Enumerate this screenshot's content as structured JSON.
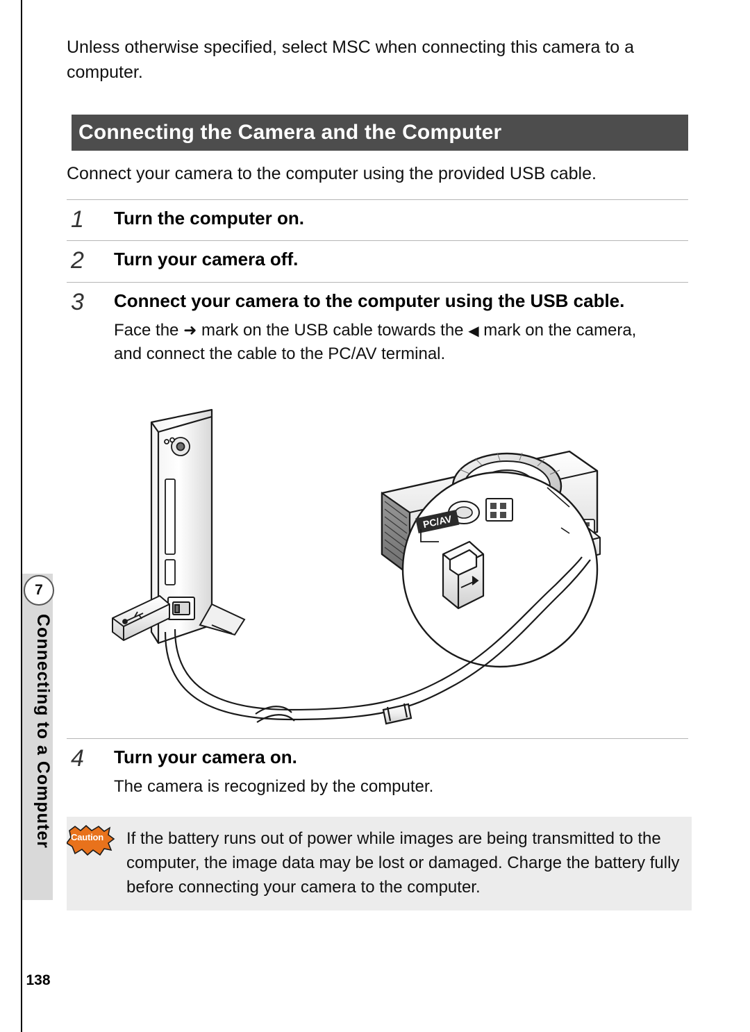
{
  "page": {
    "number": "138",
    "chapter_badge": "7",
    "side_tab_label": "Connecting to a Computer"
  },
  "intro": {
    "text": "Unless otherwise specified, select MSC when connecting this camera to a computer."
  },
  "section": {
    "title": "Connecting the Camera and the Computer",
    "lead": "Connect your camera to the computer using the provided USB cable."
  },
  "steps": [
    {
      "number": "1",
      "title": "Turn the computer on.",
      "body": ""
    },
    {
      "number": "2",
      "title": "Turn your camera off.",
      "body": ""
    },
    {
      "number": "3",
      "title": "Connect your camera to the computer using the USB cable.",
      "body_prefix": "Face the ",
      "arrow_right": "➜",
      "body_middle": " mark on the USB cable towards the ",
      "arrow_left": "◀",
      "body_suffix": " mark on the camera, and connect the cable to the PC/AV terminal."
    },
    {
      "number": "4",
      "title": "Turn your camera on.",
      "body": "The camera is recognized by the computer."
    }
  ],
  "illustration": {
    "alt": "Illustration of a computer tower and a digital camera connected by a USB cable, with an enlarged detail of the PC/AV terminal",
    "labels": {
      "camera_terminal": "PC/AV",
      "detail_terminal": "PC/AV"
    }
  },
  "caution": {
    "icon_label": "Caution",
    "text": "If the battery runs out of power while images are being transmitted to the computer, the image data may be lost or damaged. Charge the battery fully before connecting your camera to the computer."
  },
  "colors": {
    "banner_bg": "#4d4d4d",
    "caution_bg": "#ececec",
    "side_band": "#d9d9d9",
    "caution_icon": "#e8721c"
  }
}
